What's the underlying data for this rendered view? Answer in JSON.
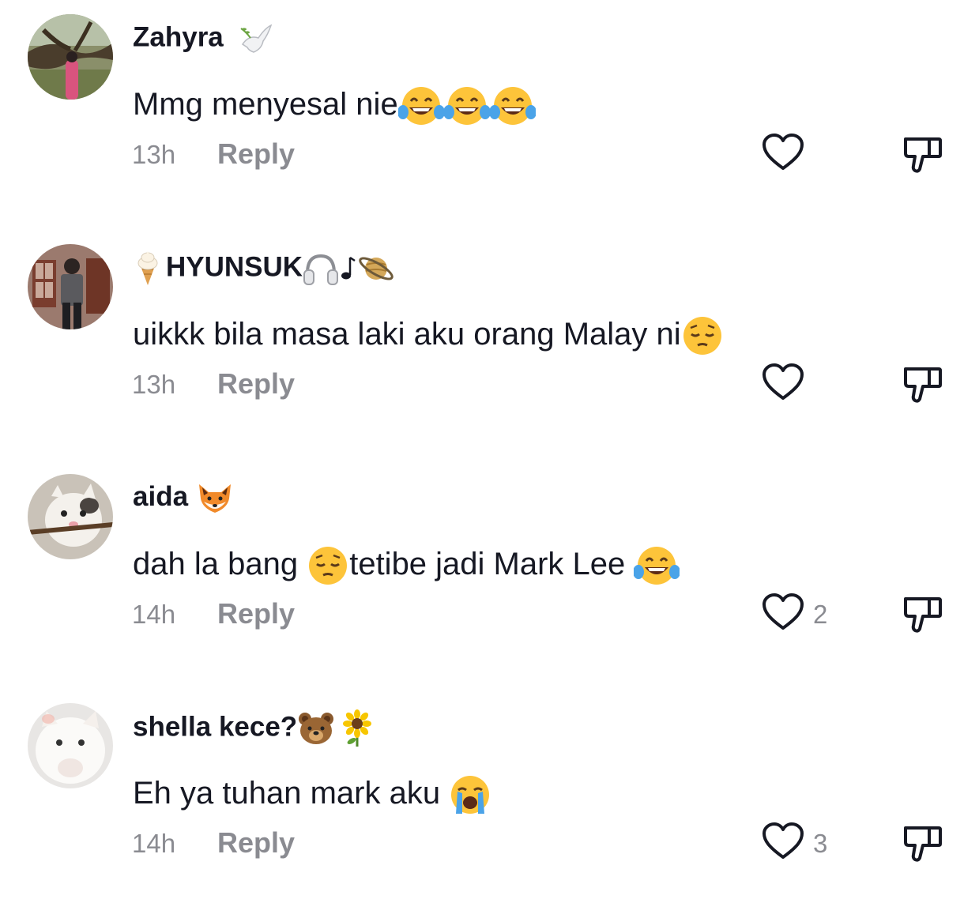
{
  "comments": [
    {
      "username": "Zahyra",
      "username_emoji": [
        "dove-icon"
      ],
      "text": "Mmg menyesal nie",
      "text_emoji": [
        "tears-of-joy-icon",
        "tears-of-joy-icon",
        "tears-of-joy-icon"
      ],
      "time": "13h",
      "reply_label": "Reply",
      "like_count": ""
    },
    {
      "username_prefix_emoji": [
        "ice-cream-icon"
      ],
      "username": "HYUNSUK",
      "username_emoji": [
        "headphones-icon",
        "music-note-icon",
        "planet-icon"
      ],
      "text": "uikkk bila masa laki aku orang Malay ni",
      "text_emoji": [
        "pensive-face-icon"
      ],
      "time": "13h",
      "reply_label": "Reply",
      "like_count": ""
    },
    {
      "username": "aida ",
      "username_emoji": [
        "fox-icon"
      ],
      "text_part1": "dah la bang ",
      "text_part2": "tetibe jadi Mark Lee ",
      "text_emoji": [
        "pensive-face-icon",
        "tears-of-joy-icon"
      ],
      "time": "14h",
      "reply_label": "Reply",
      "like_count": "2"
    },
    {
      "username": "shella kece?",
      "username_emoji": [
        "bear-icon",
        "sunflower-icon"
      ],
      "text": "Eh ya tuhan mark aku ",
      "text_emoji": [
        "crying-face-icon"
      ],
      "time": "14h",
      "reply_label": "Reply",
      "like_count": "3"
    }
  ],
  "colors": {
    "text": "#161823",
    "secondary": "#8a8b91",
    "emoji_yellow": "#fdc43a",
    "tear_blue": "#4aa3e8"
  }
}
